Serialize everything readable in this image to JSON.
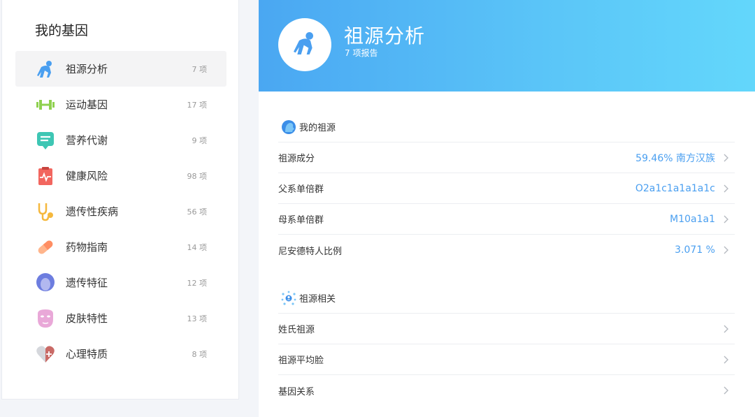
{
  "sidebar": {
    "title": "我的基因",
    "items": [
      {
        "label": "祖源分析",
        "count": "7 项",
        "icon": "ape-icon",
        "active": true
      },
      {
        "label": "运动基因",
        "count": "17 项",
        "icon": "dumbbell-icon"
      },
      {
        "label": "营养代谢",
        "count": "9 项",
        "icon": "nutrition-icon"
      },
      {
        "label": "健康风险",
        "count": "98 项",
        "icon": "health-chart-icon"
      },
      {
        "label": "遗传性疾病",
        "count": "56 项",
        "icon": "stethoscope-icon"
      },
      {
        "label": "药物指南",
        "count": "14 项",
        "icon": "pill-icon"
      },
      {
        "label": "遗传特征",
        "count": "12 项",
        "icon": "face-icon"
      },
      {
        "label": "皮肤特性",
        "count": "13 项",
        "icon": "mask-icon"
      },
      {
        "label": "心理特质",
        "count": "8 项",
        "icon": "heart-plus-icon"
      }
    ]
  },
  "banner": {
    "title": "祖源分析",
    "subtitle": "7 项报告"
  },
  "my_ancestry": {
    "title": "我的祖源",
    "rows": [
      {
        "label": "祖源成分",
        "value": "59.46% 南方汉族"
      },
      {
        "label": "父系单倍群",
        "value": "O2a1c1a1a1a1c"
      },
      {
        "label": "母系单倍群",
        "value": "M10a1a1"
      },
      {
        "label": "尼安德特人比例",
        "value": "3.071 %"
      }
    ]
  },
  "related": {
    "title": "祖源相关",
    "rows": [
      {
        "label": "姓氏祖源"
      },
      {
        "label": "祖源平均脸"
      },
      {
        "label": "基因关系"
      }
    ]
  },
  "colors": {
    "accent": "#4a9ff0",
    "banner_start": "#4aa7f2",
    "banner_end": "#63d7fb"
  }
}
